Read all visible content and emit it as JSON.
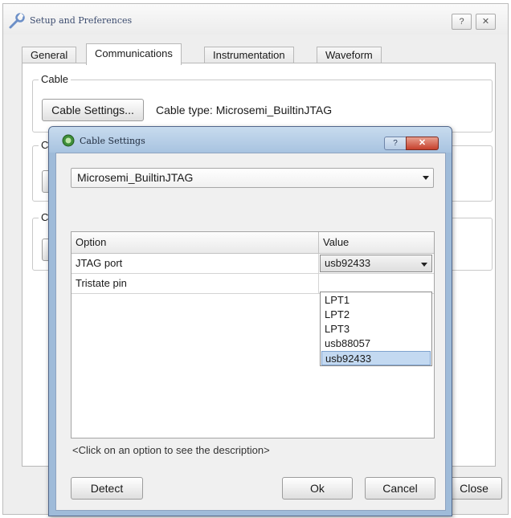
{
  "window": {
    "title": "Setup and Preferences",
    "help_glyph": "?",
    "close_glyph": "✕",
    "close_button_label": "Close"
  },
  "tabs": [
    {
      "label": "General",
      "active": false
    },
    {
      "label": "Communications",
      "active": true
    },
    {
      "label": "Instrumentation",
      "active": false
    },
    {
      "label": "Waveform",
      "active": false
    }
  ],
  "communications": {
    "cable_group_label": "Cable",
    "cable_settings_button": "Cable Settings...",
    "cable_type_text": "Cable type: Microsemi_BuiltinJTAG",
    "group2_label": "C",
    "group3_label": "C"
  },
  "dialog": {
    "title": "Cable Settings",
    "help_glyph": "?",
    "close_glyph": "✕",
    "cable_select_value": "Microsemi_BuiltinJTAG",
    "table": {
      "headers": {
        "option": "Option",
        "value": "Value"
      },
      "rows": [
        {
          "option": "JTAG port",
          "value": "usb92433"
        },
        {
          "option": "Tristate pin",
          "value": ""
        }
      ]
    },
    "dropdown_options": [
      "LPT1",
      "LPT2",
      "LPT3",
      "usb88057",
      "usb92433"
    ],
    "dropdown_selected": "usb92433",
    "hint": "<Click on an option to see the description>",
    "buttons": {
      "detect": "Detect",
      "ok": "Ok",
      "cancel": "Cancel"
    }
  },
  "colors": {
    "dialog_frame": "#9fbbd9",
    "dialog_close": "#c6402c",
    "selection": "#c3d9f1"
  }
}
